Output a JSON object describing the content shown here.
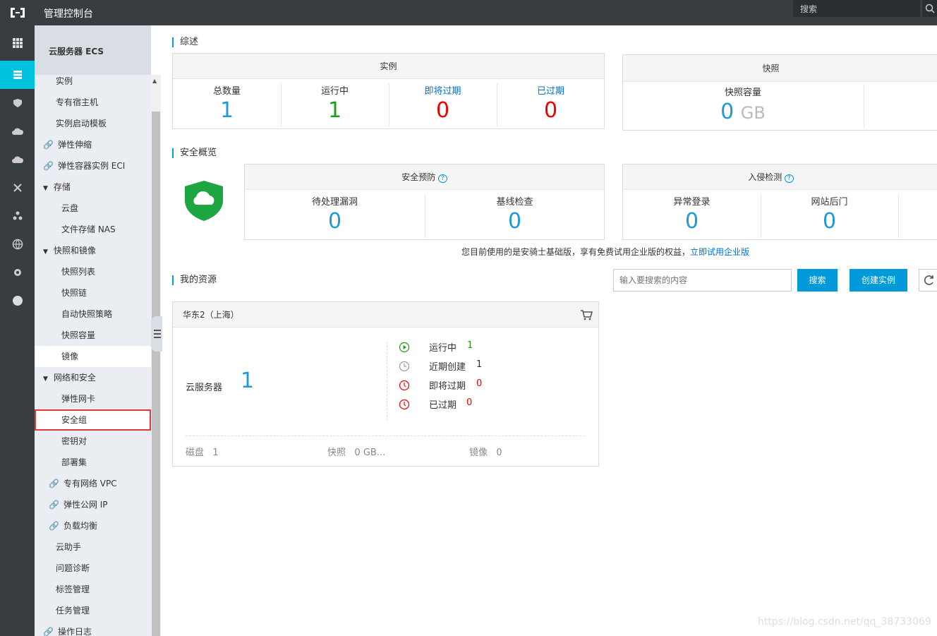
{
  "topbar": {
    "title": "管理控制台",
    "search_placeholder": "搜索"
  },
  "sidenav": {
    "heading": "云服务器 ECS",
    "items": [
      {
        "label": "实例"
      },
      {
        "label": "专有宿主机"
      },
      {
        "label": "实例启动模板"
      },
      {
        "label": "弹性伸缩"
      },
      {
        "label": "弹性容器实例 ECI"
      },
      {
        "label": "存储"
      },
      {
        "label": "云盘"
      },
      {
        "label": "文件存储 NAS"
      },
      {
        "label": "快照和镜像"
      },
      {
        "label": "快照列表"
      },
      {
        "label": "快照链"
      },
      {
        "label": "自动快照策略"
      },
      {
        "label": "快照容量"
      },
      {
        "label": "镜像"
      },
      {
        "label": "网络和安全"
      },
      {
        "label": "弹性网卡"
      },
      {
        "label": "安全组"
      },
      {
        "label": "密钥对"
      },
      {
        "label": "部署集"
      },
      {
        "label": "专有网络 VPC"
      },
      {
        "label": "弹性公网 IP"
      },
      {
        "label": "负载均衡"
      },
      {
        "label": "云助手"
      },
      {
        "label": "问题诊断"
      },
      {
        "label": "标签管理"
      },
      {
        "label": "任务管理"
      },
      {
        "label": "操作日志"
      }
    ]
  },
  "overview": {
    "title": "综述",
    "instances": {
      "header": "实例",
      "total_label": "总数量",
      "total_value": "1",
      "running_label": "运行中",
      "running_value": "1",
      "expiring_label": "即将过期",
      "expiring_value": "0",
      "expired_label": "已过期",
      "expired_value": "0"
    },
    "snapshots": {
      "header": "快照",
      "capacity_label": "快照容量",
      "capacity_value": "0",
      "capacity_unit": "GB"
    }
  },
  "security": {
    "title": "安全概览",
    "prevention": {
      "header": "安全预防",
      "vuln_label": "待处理漏洞",
      "vuln_value": "0",
      "baseline_label": "基线检查",
      "baseline_value": "0"
    },
    "intrusion": {
      "header": "入侵检测",
      "login_label": "异常登录",
      "login_value": "0",
      "backdoor_label": "网站后门",
      "backdoor_value": "0"
    },
    "notice": "您目前使用的是安骑士基础版，享有免费试用企业版的权益，",
    "notice_link": "立即试用企业版"
  },
  "resources": {
    "title": "我的资源",
    "search_placeholder": "输入要搜索的内容",
    "search_button": "搜索",
    "create_button": "创建实例",
    "region": {
      "name": "华东2（上海）",
      "server_label": "云服务器",
      "server_value": "1",
      "statuses": [
        {
          "label": "运行中",
          "value": "1"
        },
        {
          "label": "近期创建",
          "value": "1"
        },
        {
          "label": "即将过期",
          "value": "0"
        },
        {
          "label": "已过期",
          "value": "0"
        }
      ],
      "disk_label": "磁盘",
      "disk_value": "1",
      "snapshot_label": "快照",
      "snapshot_value": "0 GB...",
      "image_label": "镜像",
      "image_value": "0"
    }
  },
  "watermark": "https://blog.csdn.net/qq_38733069",
  "colors": {
    "accent": "#00c1de",
    "link": "#0070cc",
    "primary_button": "#0099d9",
    "running": "#1b9e1b",
    "alert": "#e00000",
    "value_blue": "#1e9bd7"
  }
}
